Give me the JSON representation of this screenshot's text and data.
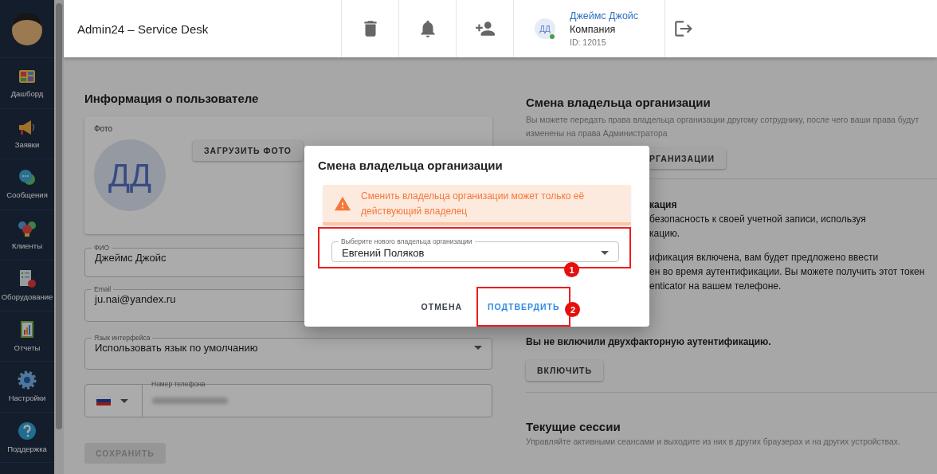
{
  "sidebar": {
    "items": [
      {
        "label": "Дашборд"
      },
      {
        "label": "Заявки"
      },
      {
        "label": "Сообщения"
      },
      {
        "label": "Клиенты"
      },
      {
        "label": "Оборудование"
      },
      {
        "label": "Отчеты"
      },
      {
        "label": "Настройки"
      },
      {
        "label": "Поддержка"
      }
    ]
  },
  "header": {
    "title": "Admin24 – Service Desk",
    "user": {
      "initials": "ДД",
      "online": true,
      "name": "Джеймс Джойс",
      "company": "Компания",
      "id": "ID: 12015"
    }
  },
  "profile": {
    "title": "Информация о пользователе",
    "photo": {
      "label": "Фото",
      "initials": "ДД",
      "upload_button": "ЗАГРУЗИТЬ ФОТО"
    },
    "fields": [
      {
        "kind": "text",
        "label": "ФИО",
        "value": "Джеймс Джойс"
      },
      {
        "kind": "text",
        "label": "Email",
        "value": "ju.nai@yandex.ru"
      },
      {
        "kind": "select",
        "label": "Язык интерфейса",
        "value": "Использовать язык по умолчанию"
      },
      {
        "kind": "phone",
        "label": "Номер телефона"
      }
    ],
    "save_button": {
      "label": "СОХРАНИТЬ",
      "disabled": true
    }
  },
  "owner_change": {
    "title": "Смена владельца организации",
    "description": "Вы можете передать права владельца организации другому сотруднику, после чего ваши права будут изменены на права Администратора",
    "button": "РГАНИЗАЦИИ"
  },
  "two_factor": {
    "title_fragment": "кация",
    "paragraphs": [
      [
        "безопасность к своей учетной записи, используя",
        "кацию."
      ],
      [
        "ификация включена, вам будет предложено ввести",
        "ен во время аутентификации. Вы можете получить этот токен",
        "enticator на вашем телефоне."
      ]
    ],
    "status": "Вы не включили двухфакторную аутентификацию.",
    "button": "ВКЛЮЧИТЬ"
  },
  "sessions": {
    "title": "Текущие сессии",
    "description": "Управляйте активными сеансами и выходите из них в других браузерах и на других устройствах."
  },
  "dialog": {
    "title": "Смена владельца организации",
    "alert": {
      "kind": "warning",
      "text": "Сменить владельца организации может только её действующий владелец"
    },
    "select": {
      "label": "Выберите нового владельца организации",
      "value": "Евгений Поляков",
      "highlighted": true,
      "annotation": "1"
    },
    "buttons": [
      {
        "kind": "text",
        "label": "ОТМЕНА",
        "highlighted": false
      },
      {
        "kind": "primary",
        "label": "ПОДТВЕРДИТЬ",
        "highlighted": true,
        "annotation": "2"
      }
    ]
  }
}
